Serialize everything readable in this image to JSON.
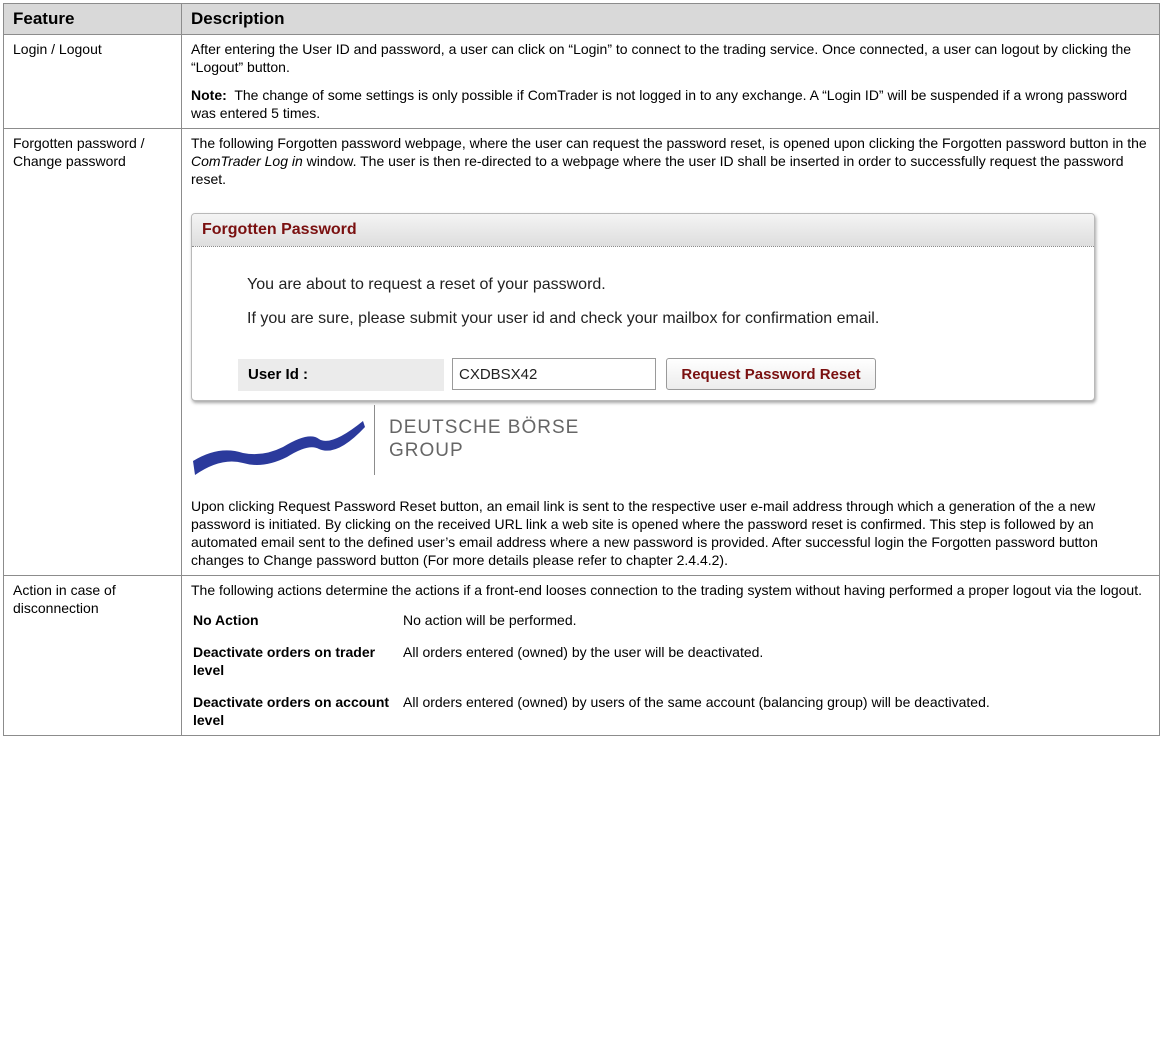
{
  "header": {
    "col1": "Feature",
    "col2": "Description"
  },
  "rows": {
    "login": {
      "feature": "Login / Logout",
      "desc": "After entering the User ID and password, a user can click on “Login” to connect to the trading service. Once connected, a user can logout by clicking the “Logout” button.",
      "note_label": "Note:",
      "note_text": "The change of some settings is only possible if ComTrader is not logged in to any exchange. A “Login ID” will be suspended if a wrong password was entered 5 times."
    },
    "forgotten": {
      "feature": "Forgotten password / Change password",
      "intro_a": "The following Forgotten password webpage, where the user can request the password reset, is opened upon clicking the Forgotten password button in the ",
      "intro_italic": "ComTrader Log in",
      "intro_b": " window. The user is then re-directed to a webpage where the user ID shall be inserted in order to successfully request the password reset.",
      "dialog": {
        "title": "Forgotten Password",
        "line1": "You are about to request a reset of your password.",
        "line2": "If you are sure, please submit your user id and check your mailbox for confirmation email.",
        "user_label": "User Id :",
        "user_value": "CXDBSX42",
        "button": "Request Password Reset"
      },
      "logo": {
        "line1": "DEUTSCHE BÖRSE",
        "line2": "GROUP",
        "color": "#2b3a9c"
      },
      "after": "Upon clicking Request Password Reset button, an email link is sent to the respective user e-mail address through which a generation of the a new password is initiated. By clicking on the received URL link a web site is opened where the password reset is confirmed. This step is followed by an automated email sent to the defined user’s email address where a new password is provided. After successful login the Forgotten password button changes to Change password button (For more details please refer to chapter 2.4.4.2)."
    },
    "action": {
      "feature": "Action in case of disconnection",
      "desc": "The following actions determine the actions if a front-end looses connection to the trading system without having performed a proper logout via the logout.",
      "items": [
        {
          "key": "No Action",
          "value": "No action will be performed."
        },
        {
          "key": "Deactivate orders on trader level",
          "value": "All orders entered (owned) by the user will be deactivated."
        },
        {
          "key": "Deactivate orders on account level",
          "value": "All orders entered (owned) by users of the same account (balancing group) will be deactivated."
        }
      ]
    }
  }
}
